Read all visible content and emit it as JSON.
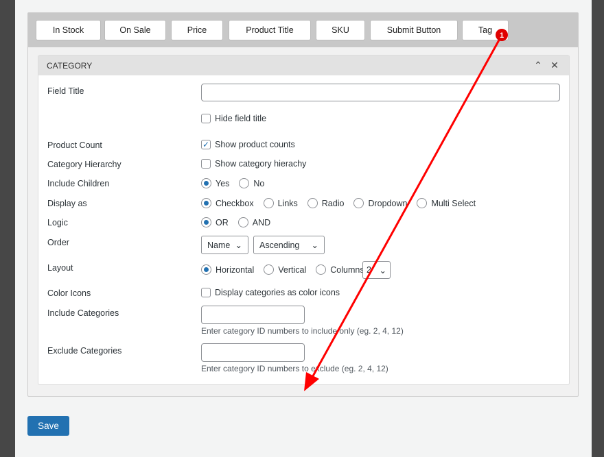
{
  "tabs": [
    "In Stock",
    "On Sale",
    "Price",
    "Product Title",
    "SKU",
    "Submit Button",
    "Tag"
  ],
  "section": {
    "title": "CATEGORY"
  },
  "fields": {
    "field_title": {
      "label": "Field Title",
      "value": ""
    },
    "hide_title": {
      "label": "Hide field title",
      "checked": false
    },
    "product_count": {
      "label": "Product Count",
      "option": "Show product counts",
      "checked": true
    },
    "hierarchy": {
      "label": "Category Hierarchy",
      "option": "Show category hierachy",
      "checked": false
    },
    "include_children": {
      "label": "Include Children",
      "options": [
        "Yes",
        "No"
      ],
      "selected": "Yes"
    },
    "display_as": {
      "label": "Display as",
      "options": [
        "Checkbox",
        "Links",
        "Radio",
        "Dropdown",
        "Multi Select"
      ],
      "selected": "Checkbox"
    },
    "logic": {
      "label": "Logic",
      "options": [
        "OR",
        "AND"
      ],
      "selected": "OR"
    },
    "order": {
      "label": "Order",
      "orderby": "Name",
      "direction": "Ascending"
    },
    "layout": {
      "label": "Layout",
      "options": [
        "Horizontal",
        "Vertical",
        "Columns"
      ],
      "selected": "Horizontal",
      "columns": "2"
    },
    "color_icons": {
      "label": "Color Icons",
      "option": "Display categories as color icons",
      "checked": false
    },
    "include": {
      "label": "Include Categories",
      "value": "",
      "help": "Enter category ID numbers to include only (eg. 2, 4, 12)"
    },
    "exclude": {
      "label": "Exclude Categories",
      "value": "",
      "help": "Enter category ID numbers to exclude (eg. 2, 4, 12)"
    }
  },
  "save_label": "Save",
  "annotation": {
    "marker": "1",
    "color": "#ff0000"
  }
}
